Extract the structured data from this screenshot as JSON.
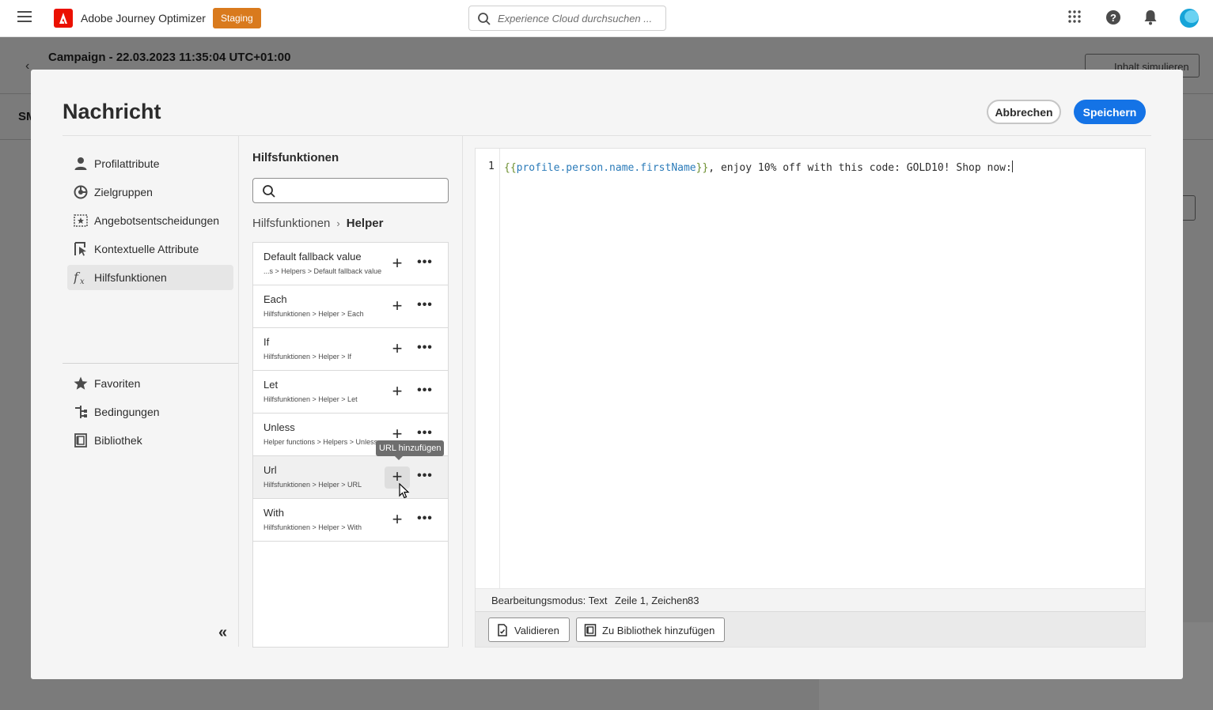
{
  "app": {
    "name": "Adobe Journey Optimizer",
    "environment": "Staging",
    "search_placeholder": "Experience Cloud durchsuchen ..."
  },
  "background": {
    "campaign_title": "Campaign - 22.03.2023 11:35:04 UTC+01:00",
    "simulate_label": "Inhalt simulieren",
    "channel_label": "SM"
  },
  "modal": {
    "title": "Nachricht",
    "cancel_label": "Abbrechen",
    "save_label": "Speichern"
  },
  "leftnav": {
    "items": [
      {
        "label": "Profilattribute",
        "icon": "person-icon"
      },
      {
        "label": "Zielgruppen",
        "icon": "audience-icon"
      },
      {
        "label": "Angebotsentscheidungen",
        "icon": "offer-icon"
      },
      {
        "label": "Kontextuelle Attribute",
        "icon": "contextual-icon"
      },
      {
        "label": "Hilfsfunktionen",
        "icon": "function-icon",
        "selected": true
      },
      {
        "label": "Favoriten",
        "icon": "star-icon"
      },
      {
        "label": "Bedingungen",
        "icon": "conditions-icon"
      },
      {
        "label": "Bibliothek",
        "icon": "library-icon"
      }
    ]
  },
  "helpers": {
    "title": "Hilfsfunktionen",
    "breadcrumb_root": "Hilfsfunktionen",
    "breadcrumb_current": "Helper",
    "items": [
      {
        "name": "Default fallback value",
        "path": "...s > Helpers > Default fallback value"
      },
      {
        "name": "Each",
        "path": "Hilfsfunktionen > Helper > Each"
      },
      {
        "name": "If",
        "path": "Hilfsfunktionen > Helper > If"
      },
      {
        "name": "Let",
        "path": "Hilfsfunktionen > Helper > Let"
      },
      {
        "name": "Unless",
        "path": "Helper functions > Helpers > Unless"
      },
      {
        "name": "Url",
        "path": "Hilfsfunktionen > Helper > URL"
      },
      {
        "name": "With",
        "path": "Hilfsfunktionen > Helper > With"
      }
    ],
    "tooltip": "URL hinzufügen"
  },
  "editor": {
    "line_number": "1",
    "code_open": "{{",
    "code_var": "profile.person.name.firstName",
    "code_close": "}}",
    "code_rest": ", enjoy 10% off with this code: GOLD10! Shop now:",
    "mode_label": "Bearbeitungsmodus: Text",
    "position_label": "Zeile 1, Zeichen",
    "position_value": "83",
    "validate_label": "Validieren",
    "add_library_label": "Zu Bibliothek hinzufügen"
  },
  "colors": {
    "primary": "#1473e6",
    "brand": "#eb1000",
    "staging": "#d97a1d"
  }
}
